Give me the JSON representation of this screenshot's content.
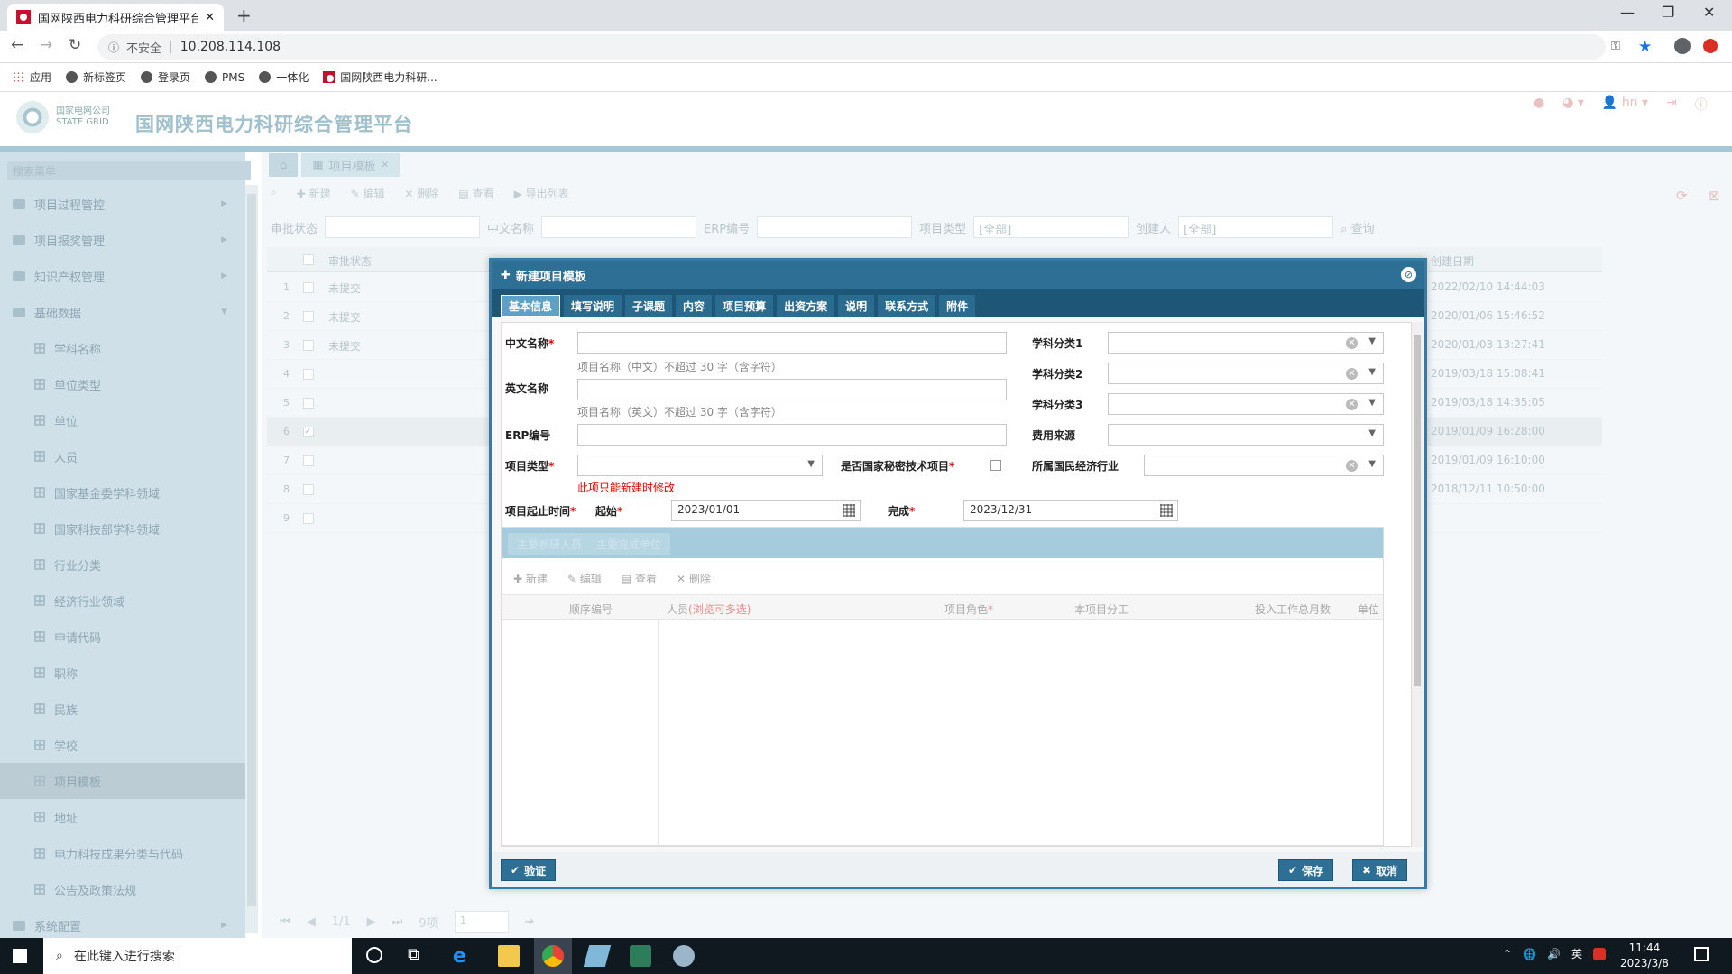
{
  "browser": {
    "tab_title": "国网陕西电力科研综合管理平台",
    "address_security": "不安全",
    "url": "10.208.114.108",
    "bookmarks": [
      "应用",
      "新标签页",
      "登录页",
      "PMS",
      "一体化",
      "国网陕西电力科研..."
    ]
  },
  "app": {
    "logo_line1": "国家电网公司",
    "logo_line2": "STATE GRID",
    "title": "国网陕西电力科研综合管理平台",
    "user": "hn"
  },
  "sidebar": {
    "search_placeholder": "搜索菜单",
    "items": [
      {
        "label": "项目过程管控",
        "type": "folder"
      },
      {
        "label": "项目报奖管理",
        "type": "folder"
      },
      {
        "label": "知识产权管理",
        "type": "folder"
      },
      {
        "label": "基础数据",
        "type": "folder-open"
      },
      {
        "label": "学科名称",
        "type": "leaf"
      },
      {
        "label": "单位类型",
        "type": "leaf"
      },
      {
        "label": "单位",
        "type": "leaf"
      },
      {
        "label": "人员",
        "type": "leaf"
      },
      {
        "label": "国家基金委学科领域",
        "type": "leaf"
      },
      {
        "label": "国家科技部学科领域",
        "type": "leaf"
      },
      {
        "label": "行业分类",
        "type": "leaf"
      },
      {
        "label": "经济行业领域",
        "type": "leaf"
      },
      {
        "label": "申请代码",
        "type": "leaf"
      },
      {
        "label": "职称",
        "type": "leaf"
      },
      {
        "label": "民族",
        "type": "leaf"
      },
      {
        "label": "学校",
        "type": "leaf"
      },
      {
        "label": "项目模板",
        "type": "leaf-active"
      },
      {
        "label": "地址",
        "type": "leaf"
      },
      {
        "label": "电力科技成果分类与代码",
        "type": "leaf"
      },
      {
        "label": "公告及政策法规",
        "type": "leaf"
      },
      {
        "label": "系统配置",
        "type": "folder"
      }
    ]
  },
  "content": {
    "tab_label": "项目模板",
    "toolbar": [
      "新建",
      "编辑",
      "删除",
      "查看",
      "导出列表"
    ],
    "filters": {
      "approval": "审批状态",
      "cn_name": "中文名称",
      "erp": "ERP编号",
      "type": "项目类型",
      "type_val": "[全部]",
      "creator": "创建人",
      "creator_val": "[全部]",
      "search": "查询"
    },
    "columns": {
      "approval": "审批状态",
      "created": "创建日期"
    },
    "rows": [
      {
        "n": "1",
        "status": "未提交",
        "date": "2022/02/10 14:44:03"
      },
      {
        "n": "2",
        "status": "未提交",
        "date": "2020/01/06 15:46:52"
      },
      {
        "n": "3",
        "status": "未提交",
        "date": "2020/01/03 13:27:41"
      },
      {
        "n": "4",
        "status": "",
        "date": "2019/03/18 15:08:41"
      },
      {
        "n": "5",
        "status": "",
        "date": "2019/03/18 14:35:05"
      },
      {
        "n": "6",
        "status": "",
        "date": "2019/01/09 16:28:00"
      },
      {
        "n": "7",
        "status": "",
        "date": "2019/01/09 16:10:00"
      },
      {
        "n": "8",
        "status": "",
        "date": "2018/12/11 10:50:00"
      },
      {
        "n": "9",
        "status": "",
        "date": ""
      }
    ],
    "pager": {
      "page": "1/1",
      "count": "9项",
      "page_input": "1"
    }
  },
  "modal": {
    "title": "新建项目模板",
    "tabs": [
      "基本信息",
      "填写说明",
      "子课题",
      "内容",
      "项目预算",
      "出资方案",
      "说明",
      "联系方式",
      "附件"
    ],
    "form": {
      "cn_name": "中文名称",
      "cn_hint": "项目名称（中文）不超过 30 字（含字符）",
      "en_name": "英文名称",
      "en_hint": "项目名称（英文）不超过 30 字（含字符）",
      "erp": "ERP编号",
      "project_type": "项目类型",
      "type_warn": "此项只能新建时修改",
      "secret": "是否国家秘密技术项目",
      "period": "项目起止时间",
      "start_label": "起始",
      "start_value": "2023/01/01",
      "end_label": "完成",
      "end_value": "2023/12/31",
      "subject1": "学科分类1",
      "subject2": "学科分类2",
      "subject3": "学科分类3",
      "fund_source": "费用来源",
      "industry": "所属国民经济行业"
    },
    "subpanel": {
      "tabs": [
        "主要参研人员",
        "主要完成单位"
      ],
      "toolbar": [
        "新建",
        "编辑",
        "查看",
        "删除"
      ],
      "columns": {
        "seq": "顺序编号",
        "person": "人员",
        "person_note": "(浏览可多选)",
        "role": "项目角色",
        "division": "本项目分工",
        "months": "投入工作总月数",
        "unit": "单位"
      }
    },
    "buttons": {
      "verify": "验证",
      "save": "保存",
      "cancel": "取消"
    }
  },
  "taskbar": {
    "search_placeholder": "在此键入进行搜索",
    "ime": "英",
    "time": "11:44",
    "date": "2023/3/8"
  }
}
